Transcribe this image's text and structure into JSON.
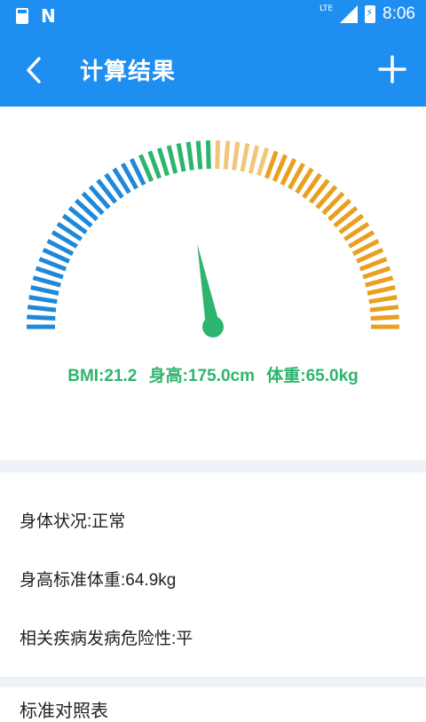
{
  "statusbar": {
    "network": "LTE",
    "time": "8:06"
  },
  "appbar": {
    "title": "计算结果"
  },
  "gauge": {
    "needle_fraction": 0.44,
    "colors": {
      "blue": "#2088d9",
      "green": "#2db56d",
      "orange": "#e8a020",
      "light_orange": "#f0c67a"
    }
  },
  "readout": {
    "bmi": "BMI:21.2",
    "height": "身高:175.0cm",
    "weight": "体重:65.0kg"
  },
  "info": {
    "condition": "身体状况:正常",
    "standard_weight": "身高标准体重:64.9kg",
    "risk": "相关疾病发病危险性:平"
  },
  "bottom": {
    "label": "标准对照表"
  }
}
